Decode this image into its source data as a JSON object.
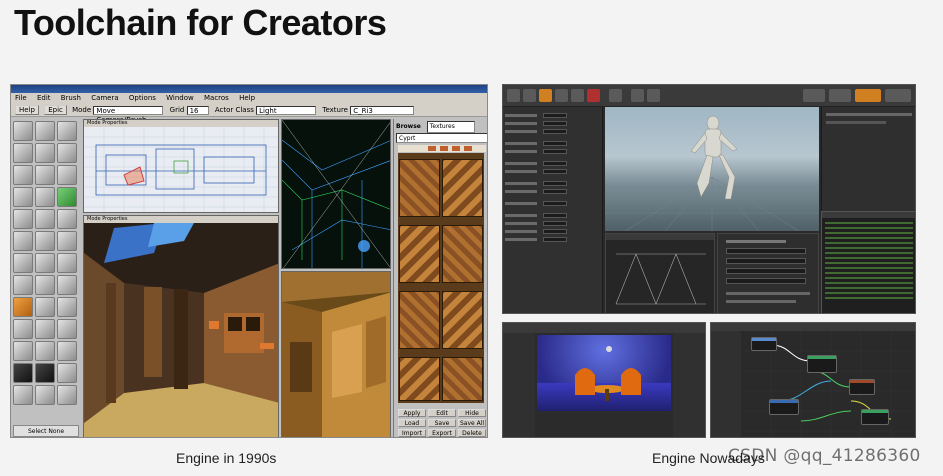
{
  "slide": {
    "title": "Toolchain for Creators",
    "caption_left": "Engine in 1990s",
    "caption_right": "Engine Nowadays",
    "watermark": "CSDN @qq_41286360"
  },
  "old_editor": {
    "menu": [
      "File",
      "Edit",
      "Brush",
      "Camera",
      "Options",
      "Window",
      "Macros",
      "Help"
    ],
    "toolbar": {
      "help_button": "Help",
      "epic_button": "Epic",
      "mode_label": "Mode",
      "mode_value": "Move Camera/Brush",
      "grid_label": "Grid",
      "grid_value": "16",
      "actor_class_label": "Actor Class",
      "actor_class_value": "Light",
      "texture_label": "Texture",
      "texture_value": "C_Ri3"
    },
    "viewport_top_label": "Mode  Properties",
    "viewport_persp_label": "Mode  Properties",
    "browser": {
      "label": "Browse",
      "type": "Textures",
      "package": "Cyprt"
    },
    "browser_buttons": [
      "Apply",
      "Edit",
      "Hide",
      "Load",
      "Save",
      "Save All",
      "Import",
      "Export",
      "Delete"
    ],
    "tool_footer": "Select None"
  },
  "modern_editor": {
    "accent_color": "#d08020"
  }
}
